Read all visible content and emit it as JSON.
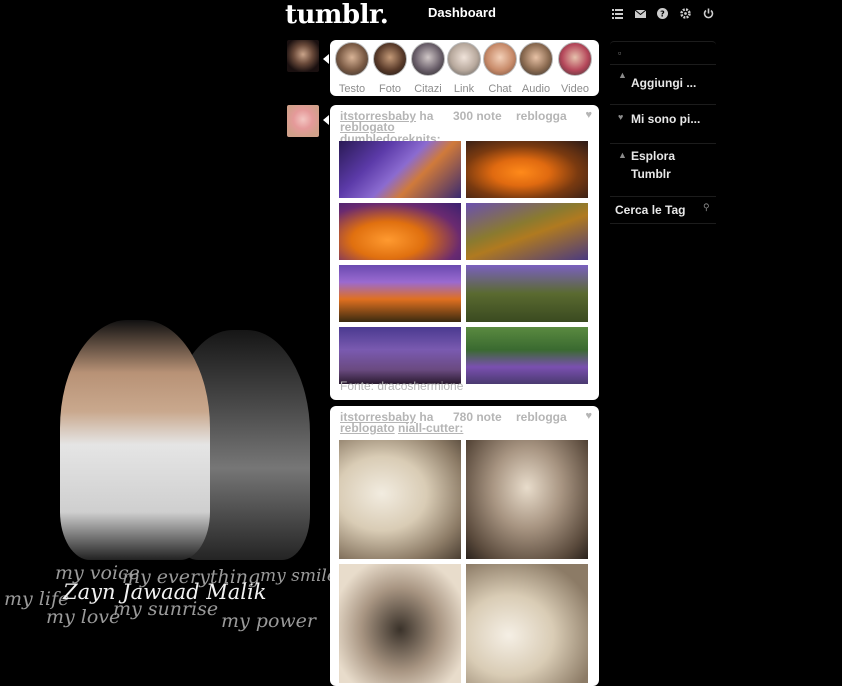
{
  "header": {
    "logo": "tumblr.",
    "dashboard": "Dashboard",
    "icons": [
      "list-icon",
      "mail-icon",
      "help-icon",
      "gear-icon",
      "power-icon"
    ]
  },
  "background_art": {
    "name": "Zayn Jawaad Malik",
    "phrases": [
      "my voice",
      "my everything",
      "my smile",
      "my life",
      "my love",
      "my sunrise",
      "my power"
    ]
  },
  "post_types": [
    {
      "label": "Testo",
      "icon": "text-icon"
    },
    {
      "label": "Foto",
      "icon": "photo-icon"
    },
    {
      "label": "Citazi",
      "icon": "quote-icon"
    },
    {
      "label": "Link",
      "icon": "link-icon"
    },
    {
      "label": "Chat",
      "icon": "chat-icon"
    },
    {
      "label": "Audio",
      "icon": "audio-icon"
    },
    {
      "label": "Video",
      "icon": "video-icon"
    }
  ],
  "posts": [
    {
      "user": "itstorresbaby",
      "verb": "ha",
      "reblogged_text": "reblogato",
      "source_user": "dumbledoreknits:",
      "notes": "300 note",
      "reblog": "reblogga",
      "source_label": "Fonte: dracoshermione"
    },
    {
      "user": "itstorresbaby",
      "verb": "ha",
      "reblogged_text": "reblogato",
      "source_user": "niall-cutter:",
      "notes": "780 note",
      "reblog": "reblogga"
    }
  ],
  "sidebar": {
    "items": [
      {
        "label": "Aggiungi ...",
        "icon": "add-user-icon"
      },
      {
        "label": "Mi sono pi...",
        "icon": "heart-icon"
      },
      {
        "label": "Esplora",
        "label2": "Tumblr",
        "icon": "compass-icon"
      },
      {
        "label": "Cerca le Tag",
        "icon": "search-icon"
      }
    ]
  },
  "colors": {
    "background": "#000000",
    "card": "#ffffff",
    "muted_text": "#b5b5b5",
    "accent_purple": "#4b2a8f",
    "accent_orange": "#e06a10"
  }
}
